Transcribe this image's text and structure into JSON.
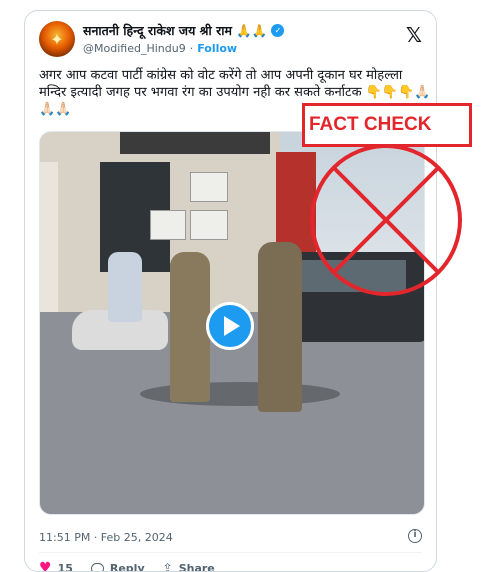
{
  "post": {
    "author_name": "सनातनी हिन्दू राकेश जय श्री राम 🙏🙏",
    "handle": "@Modified_Hindu9",
    "separator": "·",
    "follow_label": "Follow",
    "text": "अगर आप कटवा पार्टी कांग्रेस को वोट करेंगे तो आप अपनी दूकान घर मोहल्ला मन्दिर इत्यादी जगह पर भगवा रंग का उपयोग नही कर सकते कर्नाटक 👇👇👇🙏🏻🙏🏻🙏🏻",
    "timestamp": "11:51 PM · Feb 25, 2024",
    "likes": "15",
    "reply_label": "Reply",
    "share_label": "Share"
  },
  "overlay": {
    "fact_check_label": "FACT CHECK",
    "fact_check_color": "#e3262c"
  },
  "colors": {
    "accent": "#1d9bf0",
    "like": "#f91880",
    "muted": "#536471"
  },
  "icons": {
    "verified": "verified-badge-icon",
    "platform": "x-logo-icon",
    "play": "play-icon",
    "info": "info-icon",
    "like": "heart-icon",
    "reply": "reply-icon",
    "share": "share-icon"
  }
}
